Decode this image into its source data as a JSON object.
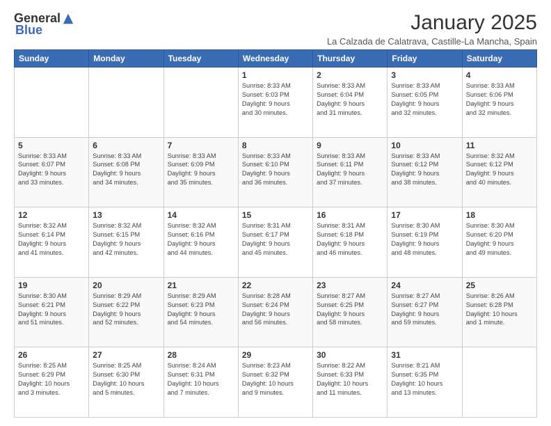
{
  "header": {
    "logo_general": "General",
    "logo_blue": "Blue",
    "title": "January 2025",
    "subtitle": "La Calzada de Calatrava, Castille-La Mancha, Spain"
  },
  "weekdays": [
    "Sunday",
    "Monday",
    "Tuesday",
    "Wednesday",
    "Thursday",
    "Friday",
    "Saturday"
  ],
  "weeks": [
    [
      {
        "day": "",
        "info": ""
      },
      {
        "day": "",
        "info": ""
      },
      {
        "day": "",
        "info": ""
      },
      {
        "day": "1",
        "info": "Sunrise: 8:33 AM\nSunset: 6:03 PM\nDaylight: 9 hours\nand 30 minutes."
      },
      {
        "day": "2",
        "info": "Sunrise: 8:33 AM\nSunset: 6:04 PM\nDaylight: 9 hours\nand 31 minutes."
      },
      {
        "day": "3",
        "info": "Sunrise: 8:33 AM\nSunset: 6:05 PM\nDaylight: 9 hours\nand 32 minutes."
      },
      {
        "day": "4",
        "info": "Sunrise: 8:33 AM\nSunset: 6:06 PM\nDaylight: 9 hours\nand 32 minutes."
      }
    ],
    [
      {
        "day": "5",
        "info": "Sunrise: 8:33 AM\nSunset: 6:07 PM\nDaylight: 9 hours\nand 33 minutes."
      },
      {
        "day": "6",
        "info": "Sunrise: 8:33 AM\nSunset: 6:08 PM\nDaylight: 9 hours\nand 34 minutes."
      },
      {
        "day": "7",
        "info": "Sunrise: 8:33 AM\nSunset: 6:09 PM\nDaylight: 9 hours\nand 35 minutes."
      },
      {
        "day": "8",
        "info": "Sunrise: 8:33 AM\nSunset: 6:10 PM\nDaylight: 9 hours\nand 36 minutes."
      },
      {
        "day": "9",
        "info": "Sunrise: 8:33 AM\nSunset: 6:11 PM\nDaylight: 9 hours\nand 37 minutes."
      },
      {
        "day": "10",
        "info": "Sunrise: 8:33 AM\nSunset: 6:12 PM\nDaylight: 9 hours\nand 38 minutes."
      },
      {
        "day": "11",
        "info": "Sunrise: 8:32 AM\nSunset: 6:12 PM\nDaylight: 9 hours\nand 40 minutes."
      }
    ],
    [
      {
        "day": "12",
        "info": "Sunrise: 8:32 AM\nSunset: 6:14 PM\nDaylight: 9 hours\nand 41 minutes."
      },
      {
        "day": "13",
        "info": "Sunrise: 8:32 AM\nSunset: 6:15 PM\nDaylight: 9 hours\nand 42 minutes."
      },
      {
        "day": "14",
        "info": "Sunrise: 8:32 AM\nSunset: 6:16 PM\nDaylight: 9 hours\nand 44 minutes."
      },
      {
        "day": "15",
        "info": "Sunrise: 8:31 AM\nSunset: 6:17 PM\nDaylight: 9 hours\nand 45 minutes."
      },
      {
        "day": "16",
        "info": "Sunrise: 8:31 AM\nSunset: 6:18 PM\nDaylight: 9 hours\nand 46 minutes."
      },
      {
        "day": "17",
        "info": "Sunrise: 8:30 AM\nSunset: 6:19 PM\nDaylight: 9 hours\nand 48 minutes."
      },
      {
        "day": "18",
        "info": "Sunrise: 8:30 AM\nSunset: 6:20 PM\nDaylight: 9 hours\nand 49 minutes."
      }
    ],
    [
      {
        "day": "19",
        "info": "Sunrise: 8:30 AM\nSunset: 6:21 PM\nDaylight: 9 hours\nand 51 minutes."
      },
      {
        "day": "20",
        "info": "Sunrise: 8:29 AM\nSunset: 6:22 PM\nDaylight: 9 hours\nand 52 minutes."
      },
      {
        "day": "21",
        "info": "Sunrise: 8:29 AM\nSunset: 6:23 PM\nDaylight: 9 hours\nand 54 minutes."
      },
      {
        "day": "22",
        "info": "Sunrise: 8:28 AM\nSunset: 6:24 PM\nDaylight: 9 hours\nand 56 minutes."
      },
      {
        "day": "23",
        "info": "Sunrise: 8:27 AM\nSunset: 6:25 PM\nDaylight: 9 hours\nand 58 minutes."
      },
      {
        "day": "24",
        "info": "Sunrise: 8:27 AM\nSunset: 6:27 PM\nDaylight: 9 hours\nand 59 minutes."
      },
      {
        "day": "25",
        "info": "Sunrise: 8:26 AM\nSunset: 6:28 PM\nDaylight: 10 hours\nand 1 minute."
      }
    ],
    [
      {
        "day": "26",
        "info": "Sunrise: 8:25 AM\nSunset: 6:29 PM\nDaylight: 10 hours\nand 3 minutes."
      },
      {
        "day": "27",
        "info": "Sunrise: 8:25 AM\nSunset: 6:30 PM\nDaylight: 10 hours\nand 5 minutes."
      },
      {
        "day": "28",
        "info": "Sunrise: 8:24 AM\nSunset: 6:31 PM\nDaylight: 10 hours\nand 7 minutes."
      },
      {
        "day": "29",
        "info": "Sunrise: 8:23 AM\nSunset: 6:32 PM\nDaylight: 10 hours\nand 9 minutes."
      },
      {
        "day": "30",
        "info": "Sunrise: 8:22 AM\nSunset: 6:33 PM\nDaylight: 10 hours\nand 11 minutes."
      },
      {
        "day": "31",
        "info": "Sunrise: 8:21 AM\nSunset: 6:35 PM\nDaylight: 10 hours\nand 13 minutes."
      },
      {
        "day": "",
        "info": ""
      }
    ]
  ]
}
